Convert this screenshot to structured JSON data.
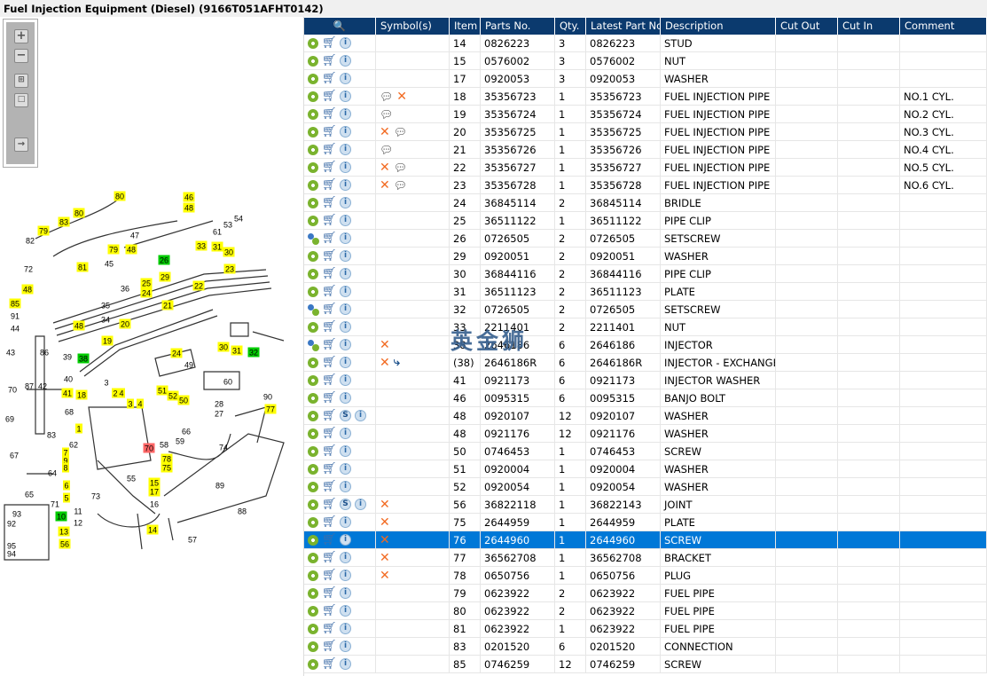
{
  "title": "Fuel Injection Equipment (Diesel) (9166T051AFHT0142)",
  "toolbar": {
    "zoom_in": "+",
    "zoom_out": "−",
    "fit": "fit-icon",
    "actual": "actual-size-icon",
    "export": "export-icon"
  },
  "callouts": [
    "80",
    "46",
    "48",
    "80",
    "83",
    "79",
    "47",
    "61",
    "53",
    "54",
    "82",
    "79",
    "48",
    "81",
    "33",
    "31",
    "30",
    "26",
    "72",
    "45",
    "29",
    "23",
    "36",
    "25",
    "24",
    "22",
    "48",
    "85",
    "21",
    "35",
    "91",
    "34",
    "20",
    "44",
    "48",
    "19",
    "30",
    "31",
    "32",
    "43",
    "86",
    "39",
    "38",
    "24",
    "49",
    "70",
    "87",
    "40",
    "42",
    "41",
    "18",
    "3",
    "2",
    "4",
    "51",
    "52",
    "50",
    "60",
    "90",
    "77",
    "28",
    "27",
    "69",
    "68",
    "83",
    "3",
    "4",
    "1",
    "66",
    "59",
    "62",
    "70",
    "58",
    "78",
    "75",
    "74",
    "67",
    "7",
    "9",
    "8",
    "64",
    "6",
    "55",
    "15",
    "17",
    "65",
    "89",
    "73",
    "5",
    "16",
    "71",
    "88",
    "11",
    "10",
    "12",
    "13",
    "14",
    "56",
    "57",
    "93",
    "92",
    "95",
    "94"
  ],
  "callout_colors": {
    "y": "#ffff00",
    "g": "#00cc00",
    "r": "#ff6666",
    "n": "transparent"
  },
  "table": {
    "columns": [
      "",
      "Symbol(s)",
      "Item",
      "Parts No.",
      "Qty.",
      "Latest Part No.",
      "Description",
      "Cut Out",
      "Cut In",
      "Comment"
    ],
    "rows": [
      {
        "item": "14",
        "part": "0826223",
        "qty": "3",
        "latest": "0826223",
        "desc": "STUD",
        "comment": "",
        "gear": "single",
        "s": false,
        "sym": []
      },
      {
        "item": "15",
        "part": "0576002",
        "qty": "3",
        "latest": "0576002",
        "desc": "NUT",
        "comment": "",
        "gear": "single",
        "s": false,
        "sym": []
      },
      {
        "item": "17",
        "part": "0920053",
        "qty": "3",
        "latest": "0920053",
        "desc": "WASHER",
        "comment": "",
        "gear": "single",
        "s": false,
        "sym": []
      },
      {
        "item": "18",
        "part": "35356723",
        "qty": "1",
        "latest": "35356723",
        "desc": "FUEL INJECTION PIPE",
        "comment": "NO.1 CYL.",
        "gear": "single",
        "s": false,
        "sym": [
          "note",
          "x"
        ]
      },
      {
        "item": "19",
        "part": "35356724",
        "qty": "1",
        "latest": "35356724",
        "desc": "FUEL INJECTION PIPE",
        "comment": "NO.2 CYL.",
        "gear": "single",
        "s": false,
        "sym": [
          "note"
        ]
      },
      {
        "item": "20",
        "part": "35356725",
        "qty": "1",
        "latest": "35356725",
        "desc": "FUEL INJECTION PIPE",
        "comment": "NO.3 CYL.",
        "gear": "single",
        "s": false,
        "sym": [
          "x",
          "note"
        ]
      },
      {
        "item": "21",
        "part": "35356726",
        "qty": "1",
        "latest": "35356726",
        "desc": "FUEL INJECTION PIPE",
        "comment": "NO.4 CYL.",
        "gear": "single",
        "s": false,
        "sym": [
          "note"
        ]
      },
      {
        "item": "22",
        "part": "35356727",
        "qty": "1",
        "latest": "35356727",
        "desc": "FUEL INJECTION PIPE",
        "comment": "NO.5 CYL.",
        "gear": "single",
        "s": false,
        "sym": [
          "x",
          "note"
        ]
      },
      {
        "item": "23",
        "part": "35356728",
        "qty": "1",
        "latest": "35356728",
        "desc": "FUEL INJECTION PIPE",
        "comment": "NO.6 CYL.",
        "gear": "single",
        "s": false,
        "sym": [
          "x",
          "note"
        ]
      },
      {
        "item": "24",
        "part": "36845114",
        "qty": "2",
        "latest": "36845114",
        "desc": "BRIDLE",
        "comment": "",
        "gear": "single",
        "s": false,
        "sym": []
      },
      {
        "item": "25",
        "part": "36511122",
        "qty": "1",
        "latest": "36511122",
        "desc": "PIPE CLIP",
        "comment": "",
        "gear": "single",
        "s": false,
        "sym": []
      },
      {
        "item": "26",
        "part": "0726505",
        "qty": "2",
        "latest": "0726505",
        "desc": "SETSCREW",
        "comment": "",
        "gear": "multi",
        "s": false,
        "sym": []
      },
      {
        "item": "29",
        "part": "0920051",
        "qty": "2",
        "latest": "0920051",
        "desc": "WASHER",
        "comment": "",
        "gear": "single",
        "s": false,
        "sym": []
      },
      {
        "item": "30",
        "part": "36844116",
        "qty": "2",
        "latest": "36844116",
        "desc": "PIPE CLIP",
        "comment": "",
        "gear": "single",
        "s": false,
        "sym": []
      },
      {
        "item": "31",
        "part": "36511123",
        "qty": "2",
        "latest": "36511123",
        "desc": "PLATE",
        "comment": "",
        "gear": "single",
        "s": false,
        "sym": []
      },
      {
        "item": "32",
        "part": "0726505",
        "qty": "2",
        "latest": "0726505",
        "desc": "SETSCREW",
        "comment": "",
        "gear": "multi",
        "s": false,
        "sym": []
      },
      {
        "item": "33",
        "part": "2211401",
        "qty": "2",
        "latest": "2211401",
        "desc": "NUT",
        "comment": "",
        "gear": "single",
        "s": false,
        "sym": []
      },
      {
        "item": "38",
        "part": "2646186",
        "qty": "6",
        "latest": "2646186",
        "desc": "INJECTOR",
        "comment": "",
        "gear": "multi",
        "s": false,
        "sym": [
          "x"
        ]
      },
      {
        "item": "(38)",
        "part": "2646186R",
        "qty": "6",
        "latest": "2646186R",
        "desc": "INJECTOR - EXCHANGE",
        "comment": "",
        "gear": "single",
        "s": false,
        "sym": [
          "x",
          "swap"
        ]
      },
      {
        "item": "41",
        "part": "0921173",
        "qty": "6",
        "latest": "0921173",
        "desc": "INJECTOR WASHER",
        "comment": "",
        "gear": "single",
        "s": false,
        "sym": []
      },
      {
        "item": "46",
        "part": "0095315",
        "qty": "6",
        "latest": "0095315",
        "desc": "BANJO BOLT",
        "comment": "",
        "gear": "single",
        "s": false,
        "sym": []
      },
      {
        "item": "48",
        "part": "0920107",
        "qty": "12",
        "latest": "0920107",
        "desc": "WASHER",
        "comment": "",
        "gear": "single",
        "s": true,
        "sym": []
      },
      {
        "item": "48",
        "part": "0921176",
        "qty": "12",
        "latest": "0921176",
        "desc": "WASHER",
        "comment": "",
        "gear": "single",
        "s": false,
        "sym": []
      },
      {
        "item": "50",
        "part": "0746453",
        "qty": "1",
        "latest": "0746453",
        "desc": "SCREW",
        "comment": "",
        "gear": "single",
        "s": false,
        "sym": []
      },
      {
        "item": "51",
        "part": "0920004",
        "qty": "1",
        "latest": "0920004",
        "desc": "WASHER",
        "comment": "",
        "gear": "single",
        "s": false,
        "sym": []
      },
      {
        "item": "52",
        "part": "0920054",
        "qty": "1",
        "latest": "0920054",
        "desc": "WASHER",
        "comment": "",
        "gear": "single",
        "s": false,
        "sym": []
      },
      {
        "item": "56",
        "part": "36822118",
        "qty": "1",
        "latest": "36822143",
        "desc": "JOINT",
        "comment": "",
        "gear": "single",
        "s": true,
        "sym": [
          "x"
        ]
      },
      {
        "item": "75",
        "part": "2644959",
        "qty": "1",
        "latest": "2644959",
        "desc": "PLATE",
        "comment": "",
        "gear": "single",
        "s": false,
        "sym": [
          "x"
        ]
      },
      {
        "item": "76",
        "part": "2644960",
        "qty": "1",
        "latest": "2644960",
        "desc": "SCREW",
        "comment": "",
        "gear": "single",
        "s": false,
        "sym": [
          "x"
        ],
        "selected": true
      },
      {
        "item": "77",
        "part": "36562708",
        "qty": "1",
        "latest": "36562708",
        "desc": "BRACKET",
        "comment": "",
        "gear": "single",
        "s": false,
        "sym": [
          "x"
        ]
      },
      {
        "item": "78",
        "part": "0650756",
        "qty": "1",
        "latest": "0650756",
        "desc": "PLUG",
        "comment": "",
        "gear": "single",
        "s": false,
        "sym": [
          "x"
        ]
      },
      {
        "item": "79",
        "part": "0623922",
        "qty": "2",
        "latest": "0623922",
        "desc": "FUEL PIPE",
        "comment": "",
        "gear": "single",
        "s": false,
        "sym": []
      },
      {
        "item": "80",
        "part": "0623922",
        "qty": "2",
        "latest": "0623922",
        "desc": "FUEL PIPE",
        "comment": "",
        "gear": "single",
        "s": false,
        "sym": []
      },
      {
        "item": "81",
        "part": "0623922",
        "qty": "1",
        "latest": "0623922",
        "desc": "FUEL PIPE",
        "comment": "",
        "gear": "single",
        "s": false,
        "sym": []
      },
      {
        "item": "83",
        "part": "0201520",
        "qty": "6",
        "latest": "0201520",
        "desc": "CONNECTION",
        "comment": "",
        "gear": "single",
        "s": false,
        "sym": []
      },
      {
        "item": "85",
        "part": "0746259",
        "qty": "12",
        "latest": "0746259",
        "desc": "SCREW",
        "comment": "",
        "gear": "single",
        "s": false,
        "sym": []
      }
    ]
  },
  "watermark": "英金狮"
}
